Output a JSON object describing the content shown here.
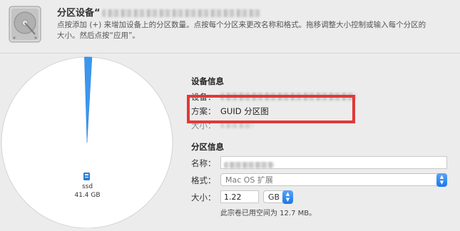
{
  "header": {
    "title": "分区设备“",
    "description": "点按添加 (+) 来增加设备上的分区数量。点按每个分区来更改名称和格式。拖移调整大小控制或输入每个分区的大小。然后点按“应用”。"
  },
  "pie": {
    "partition_name": "ssd",
    "partition_size": "41.4 GB",
    "small_slice_fraction": 0.014
  },
  "device_info": {
    "heading": "设备信息",
    "device_label": "设备：",
    "scheme_label": "方案：",
    "scheme_value": "GUID 分区图",
    "size_label": "大小："
  },
  "partition_info": {
    "heading": "分区信息",
    "name_label": "名称：",
    "format_label": "格式：",
    "format_value": "Mac OS 扩展",
    "size_label": "大小：",
    "size_value": "1.22",
    "unit_value": "GB",
    "used_note": "此宗卷已用空间为 12.7 MB。"
  },
  "colors": {
    "slice": "#3b97ee",
    "highlight": "#e23838",
    "accent": "#1b76ea"
  }
}
